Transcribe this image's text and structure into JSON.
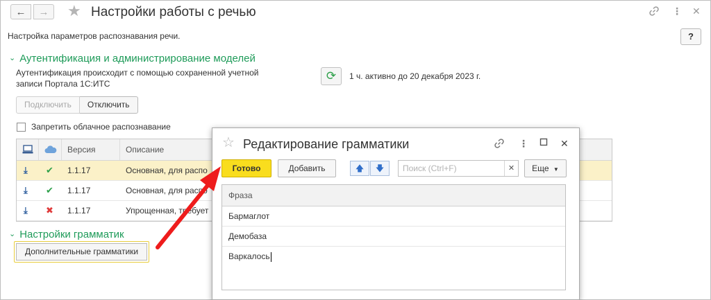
{
  "window": {
    "title": "Настройки работы с речью",
    "subtitle": "Настройка параметров распознавания речи.",
    "help_label": "?"
  },
  "icons": {
    "back": "arrow-left-icon",
    "forward": "arrow-right-icon",
    "favorite": "star-icon",
    "link": "link-icon",
    "more": "more-vertical-icon",
    "close": "close-icon"
  },
  "auth_section": {
    "title": "Аутентификация и администрирование моделей",
    "description": "Аутентификация происходит с помощью сохраненной учетной записи Портала 1С:ИТС",
    "active_status": "1 ч. активно до 20 декабря 2023 г.",
    "connect_label": "Подключить",
    "disconnect_label": "Отключить",
    "forbid_cloud_label": "Запретить облачное распознавание"
  },
  "models_table": {
    "headers": {
      "version": "Версия",
      "description": "Описание"
    },
    "rows": [
      {
        "status": "ok",
        "version": "1.1.17",
        "description": "Основная, для распо"
      },
      {
        "status": "ok",
        "version": "1.1.17",
        "description": "Основная, для распо"
      },
      {
        "status": "error",
        "version": "1.1.17",
        "description": "Упрощенная, требует"
      }
    ]
  },
  "grammar_section": {
    "title": "Настройки грамматик",
    "additional_label": "Дополнительные грамматики"
  },
  "dialog": {
    "title": "Редактирование грамматики",
    "ready_label": "Готово",
    "add_label": "Добавить",
    "search_placeholder": "Поиск (Ctrl+F)",
    "more_label": "Еще",
    "column_header": "Фраза",
    "phrases": [
      "Бармаглот",
      "Демобаза",
      "Варкалось"
    ]
  },
  "colors": {
    "section_green": "#1e9b59",
    "ready_yellow": "#f9dd1e",
    "selected_row": "#fbf1c8",
    "annotation_arrow": "#ee1c1c"
  }
}
